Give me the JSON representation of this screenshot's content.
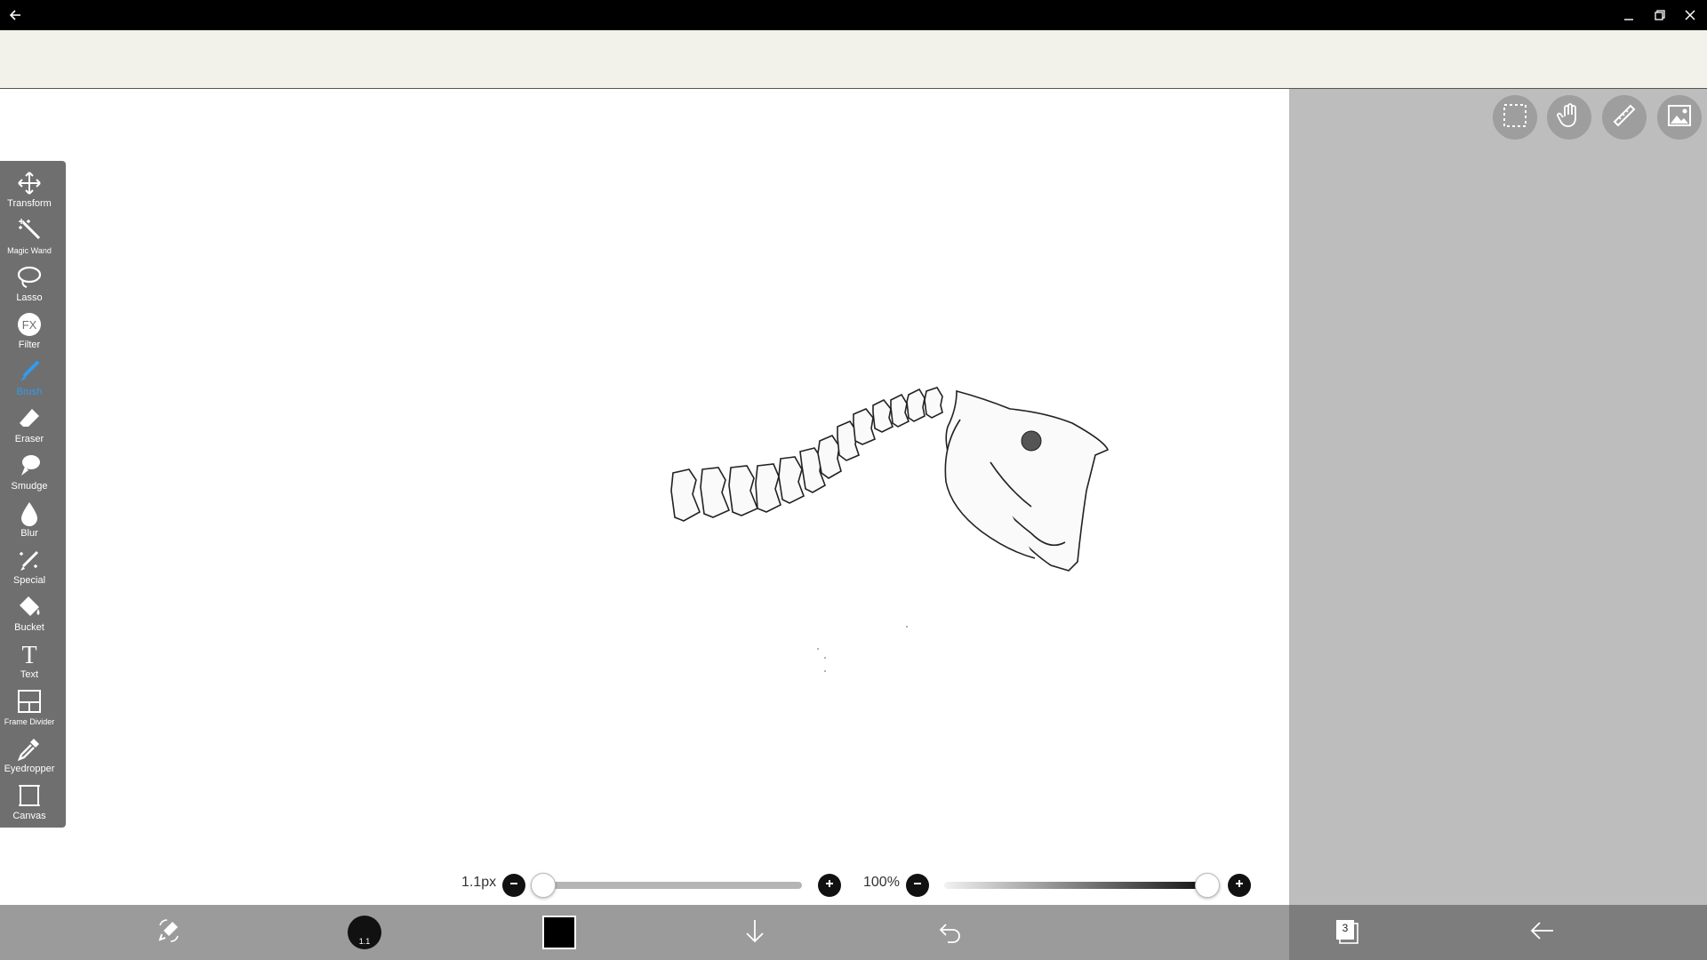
{
  "window": {
    "back_icon": "back-arrow-icon",
    "minimize_icon": "minimize-icon",
    "maximize_icon": "restore-icon",
    "close_icon": "close-icon"
  },
  "top_buttons": [
    {
      "name": "selection",
      "icon": "dashed-selection-icon"
    },
    {
      "name": "hand",
      "icon": "hand-icon"
    },
    {
      "name": "ruler",
      "icon": "ruler-icon"
    },
    {
      "name": "image",
      "icon": "image-icon"
    }
  ],
  "tools": [
    {
      "id": "transform",
      "label": "Transform",
      "icon": "move-arrows-icon"
    },
    {
      "id": "magic-wand",
      "label": "Magic Wand",
      "icon": "magic-wand-icon"
    },
    {
      "id": "lasso",
      "label": "Lasso",
      "icon": "lasso-icon"
    },
    {
      "id": "filter",
      "label": "Filter",
      "icon": "fx-icon"
    },
    {
      "id": "brush",
      "label": "Brush",
      "icon": "brush-icon",
      "active": true
    },
    {
      "id": "eraser",
      "label": "Eraser",
      "icon": "eraser-icon"
    },
    {
      "id": "smudge",
      "label": "Smudge",
      "icon": "smudge-icon"
    },
    {
      "id": "blur",
      "label": "Blur",
      "icon": "drop-icon"
    },
    {
      "id": "special",
      "label": "Special",
      "icon": "special-brush-icon"
    },
    {
      "id": "bucket",
      "label": "Bucket",
      "icon": "bucket-icon"
    },
    {
      "id": "text",
      "label": "Text",
      "icon": "text-icon"
    },
    {
      "id": "frame-divider",
      "label": "Frame Divider",
      "icon": "frame-divider-icon"
    },
    {
      "id": "eyedropper",
      "label": "Eyedropper",
      "icon": "eyedropper-icon"
    },
    {
      "id": "canvas",
      "label": "Canvas",
      "icon": "canvas-icon"
    }
  ],
  "brush_size": {
    "label": "1.1px",
    "fraction": 0.0
  },
  "opacity": {
    "label": "100%",
    "fraction": 1.0
  },
  "bottom_bar": {
    "layers_count": "3",
    "brush_preview_size": "1.1",
    "color": "#000000",
    "items": [
      "swap-icon",
      "brush-preview",
      "color-swatch",
      "down-arrow-icon",
      "undo-icon",
      "layers-icon",
      "back-arrow-icon"
    ]
  },
  "colors": {
    "active_tool": "#2e9cf2",
    "toolbar_bg": "#6f6f6f",
    "side_bg": "#bdbdbd"
  }
}
